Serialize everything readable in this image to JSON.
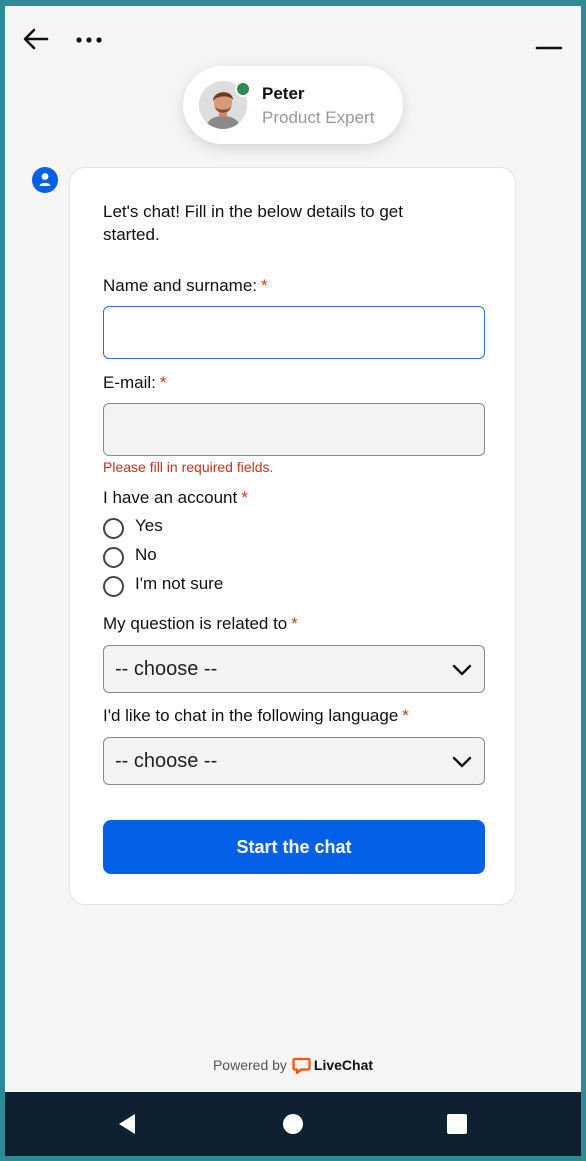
{
  "header": {
    "icons": [
      "back-arrow-icon",
      "more-dots-icon",
      "minimize-icon"
    ]
  },
  "agent": {
    "name": "Peter",
    "role": "Product Expert",
    "status_color": "#2e8b57"
  },
  "form": {
    "intro": "Let's chat! Fill in the below details to get started.",
    "name_label": "Name and surname:",
    "email_label": "E-mail:",
    "error_message": "Please fill in required fields.",
    "account_label": "I have an account",
    "account_options": [
      "Yes",
      "No",
      "I'm not sure"
    ],
    "question_label": "My question is related to",
    "question_value": "-- choose --",
    "language_label": "I'd like to chat in the following language",
    "language_value": "-- choose --",
    "required_mark": "*",
    "submit_label": "Start the chat"
  },
  "footer": {
    "powered_by": "Powered by",
    "brand": "LiveChat"
  },
  "colors": {
    "accent": "#0560e8",
    "error": "#c4341c",
    "brand_orange": "#ff5100"
  }
}
